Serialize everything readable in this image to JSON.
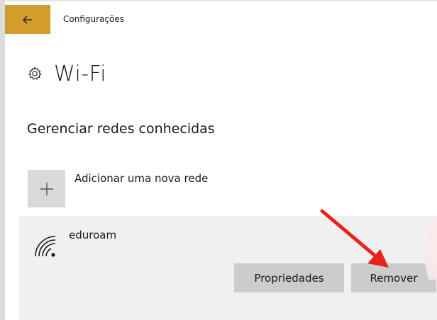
{
  "window": {
    "app_title": "Configurações"
  },
  "page": {
    "title": "Wi-Fi",
    "section_title": "Gerenciar redes conhecidas"
  },
  "add_network": {
    "label": "Adicionar uma nova rede"
  },
  "network": {
    "name": "eduroam",
    "properties_label": "Propriedades",
    "remove_label": "Remover"
  },
  "colors": {
    "accent": "#d39d2d",
    "annotation_arrow": "#e8231c",
    "card_background": "#f0f0f0",
    "button_background": "#cccccc"
  },
  "icons": {
    "back": "back-arrow-icon",
    "settings": "gear-icon",
    "add": "plus-icon",
    "network": "wifi-icon"
  }
}
